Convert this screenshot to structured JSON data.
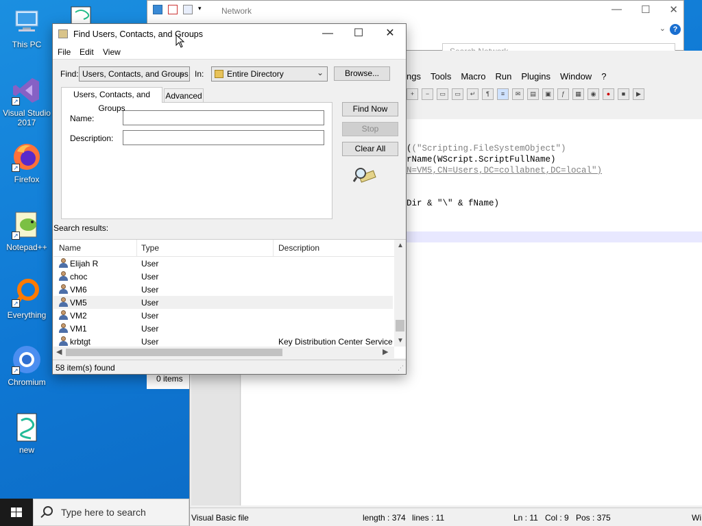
{
  "desktop": {
    "icons": [
      {
        "label": "This PC"
      },
      {
        "label": "Visual Studio 2017"
      },
      {
        "label": "Firefox"
      },
      {
        "label": "Notepad++"
      },
      {
        "label": "Everything"
      },
      {
        "label": "Chromium"
      },
      {
        "label": "new"
      }
    ]
  },
  "explorer": {
    "title": "Network",
    "search_placeholder": "Search Network",
    "status": "0 items"
  },
  "notepadpp": {
    "menu": [
      "ngs",
      "Tools",
      "Macro",
      "Run",
      "Plugins",
      "Window",
      "?"
    ],
    "code_lines": [
      "(\"Scripting.FileSystemObject\")",
      "rName(WScript.ScriptFullName)",
      "N=VM5,CN=Users,DC=collabnet,DC=local\")",
      "Dir & \"\\\" & fName)"
    ],
    "status": {
      "filetype": "Visual Basic file",
      "length": "length : 374",
      "lines": "lines : 11",
      "ln": "Ln : 11",
      "col": "Col : 9",
      "pos": "Pos : 375",
      "extra": "Wi"
    }
  },
  "dialog": {
    "title": "Find Users, Contacts, and Groups",
    "menu": {
      "file": "File",
      "edit": "Edit",
      "view": "View"
    },
    "find_label": "Find:",
    "find_value": "Users, Contacts, and Groups",
    "in_label": "In:",
    "in_value": "Entire Directory",
    "browse_label": "Browse...",
    "tabs": {
      "main": "Users, Contacts, and Groups",
      "advanced": "Advanced"
    },
    "name_label": "Name:",
    "name_value": "",
    "description_label": "Description:",
    "description_value": "",
    "buttons": {
      "find_now": "Find Now",
      "stop": "Stop",
      "clear_all": "Clear All"
    },
    "search_results_label": "Search results:",
    "columns": {
      "name": "Name",
      "type": "Type",
      "description": "Description"
    },
    "rows": [
      {
        "name": "Elijah R",
        "type": "User",
        "description": ""
      },
      {
        "name": "choc",
        "type": "User",
        "description": ""
      },
      {
        "name": "VM6",
        "type": "User",
        "description": ""
      },
      {
        "name": "VM5",
        "type": "User",
        "description": ""
      },
      {
        "name": "VM2",
        "type": "User",
        "description": ""
      },
      {
        "name": "VM1",
        "type": "User",
        "description": ""
      },
      {
        "name": "krbtgt",
        "type": "User",
        "description": "Key Distribution Center Service A"
      }
    ],
    "status": "58 item(s) found"
  },
  "taskbar": {
    "search_placeholder": "Type here to search"
  },
  "colors": {
    "desktop": "#0f78d4",
    "dialog_bg": "#f0f0f0",
    "selected_row": "#f0f0f0"
  }
}
